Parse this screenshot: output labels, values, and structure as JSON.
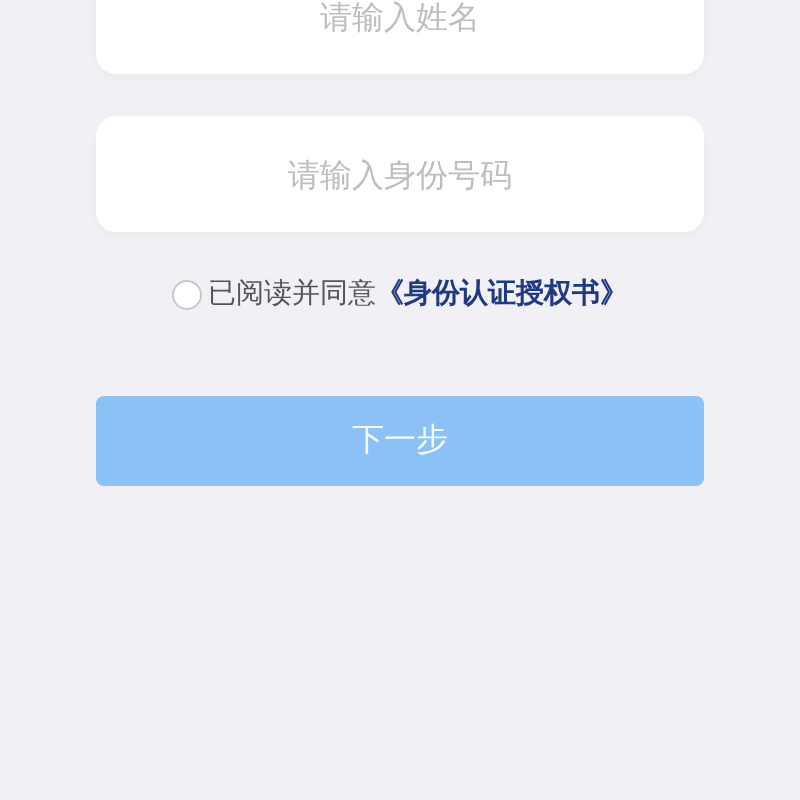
{
  "fields": [
    {
      "placeholder": "请输入姓名"
    },
    {
      "placeholder": "请输入身份号码"
    }
  ],
  "agreement": {
    "checked": false,
    "text": "已阅读并同意",
    "link": "《身份认证授权书》"
  },
  "next_button": {
    "label": "下一步",
    "disabled": true
  }
}
